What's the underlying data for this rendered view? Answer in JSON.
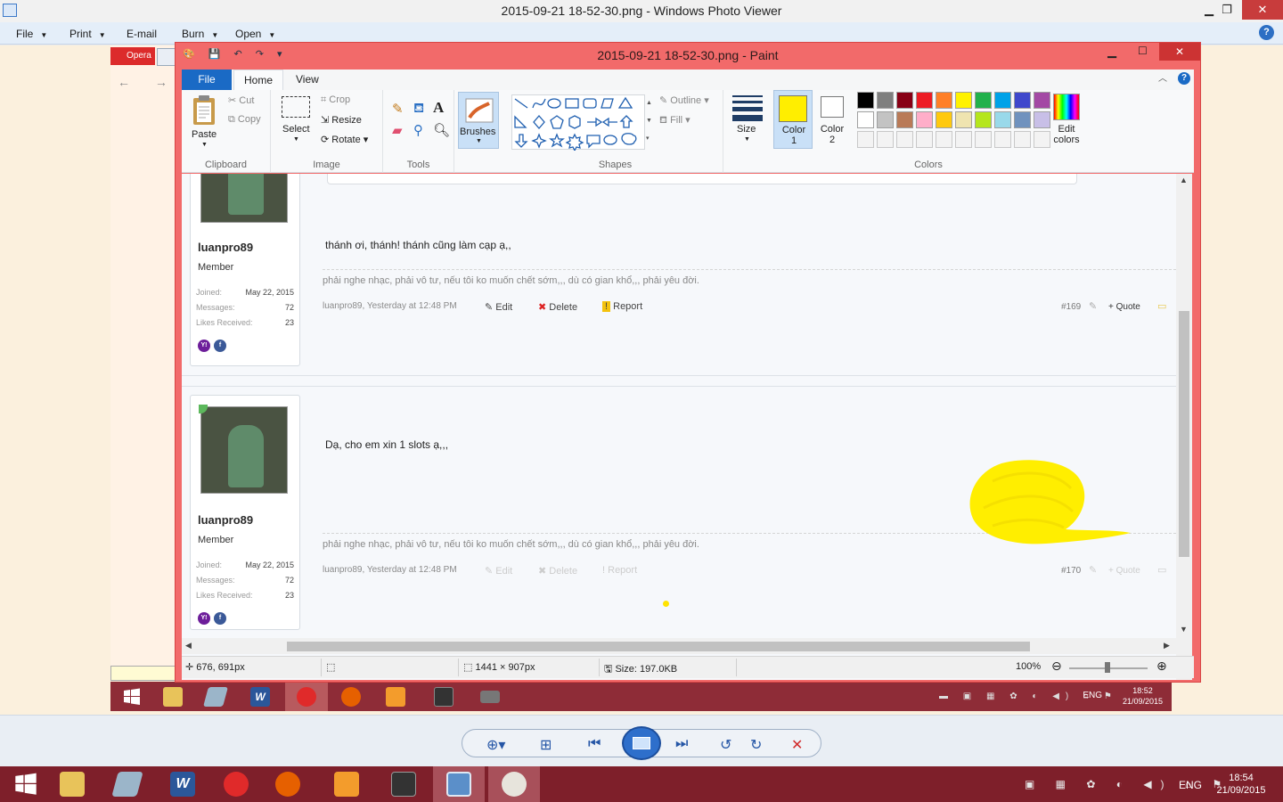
{
  "photo_viewer": {
    "title": "2015-09-21 18-52-30.png - Windows Photo Viewer",
    "menu": [
      "File",
      "Print",
      "E-mail",
      "Burn",
      "Open"
    ],
    "help": "?"
  },
  "browser_strip": {
    "tab_label": "Opera",
    "nav": "← → C"
  },
  "paint": {
    "title": "2015-09-21 18-52-30.png - Paint",
    "tabs": {
      "file": "File",
      "home": "Home",
      "view": "View"
    },
    "clipboard": {
      "paste": "Paste",
      "cut": "Cut",
      "copy": "Copy",
      "group": "Clipboard"
    },
    "image": {
      "select": "Select",
      "crop": "Crop",
      "resize": "Resize",
      "rotate": "Rotate",
      "group": "Image"
    },
    "tools": {
      "group": "Tools"
    },
    "brushes": {
      "label": "Brushes"
    },
    "shapes": {
      "outline": "Outline",
      "fill": "Fill",
      "group": "Shapes"
    },
    "size": {
      "label": "Size"
    },
    "colors": {
      "color1": "Color 1",
      "color2": "Color 2",
      "edit": "Edit colors",
      "group": "Colors",
      "color1_value": "#ffee00",
      "palette": [
        "#000000",
        "#7f7f7f",
        "#880015",
        "#ed1c24",
        "#ff7f27",
        "#fff200",
        "#22b14c",
        "#00a2e8",
        "#3f48cc",
        "#a349a4",
        "#ffffff",
        "#c3c3c3",
        "#b97a57",
        "#ffaec9",
        "#ffc90e",
        "#efe4b0",
        "#b5e61d",
        "#99d9ea",
        "#7092be",
        "#c8bfe7"
      ]
    },
    "status": {
      "coords": "676, 691px",
      "dims": "1441 × 907px",
      "size": "Size: 197.0KB",
      "zoom": "100%"
    }
  },
  "forum": {
    "posts": [
      {
        "username": "luanpro89",
        "role": "Member",
        "joined_label": "Joined:",
        "joined": "May 22, 2015",
        "messages_label": "Messages:",
        "messages": "72",
        "likes_label": "Likes Received:",
        "likes": "23",
        "message": "thánh ơi, thánh! thánh cũng làm cạp ạ,,",
        "signature": "phải nghe nhạc, phải vô tư, nếu tôi ko muốn chết sớm,,, dù có gian khổ,,, phải yêu đời.",
        "meta": "luanpro89, Yesterday at 12:48 PM",
        "edit": "Edit",
        "delete": "Delete",
        "report": "Report",
        "number": "#169",
        "quote": "+ Quote"
      },
      {
        "username": "luanpro89",
        "role": "Member",
        "joined_label": "Joined:",
        "joined": "May 22, 2015",
        "messages_label": "Messages:",
        "messages": "72",
        "likes_label": "Likes Received:",
        "likes": "23",
        "message": "Dạ, cho em xin 1 slots ạ,,,",
        "signature": "phải nghe nhạc, phải vô tư, nếu tôi ko muốn chết sớm,,, dù có gian khổ,,, phải yêu đời.",
        "meta": "luanpro89, Yesterday at 12:48 PM",
        "edit": "Edit",
        "delete": "Delete",
        "report": "Report",
        "number": "#170",
        "quote": "+ Quote"
      }
    ]
  },
  "inner_taskbar": {
    "lang": "ENG",
    "time": "18:52",
    "date": "21/09/2015"
  },
  "taskbar": {
    "lang": "ENG",
    "time": "18:54",
    "date": "21/09/2015"
  }
}
